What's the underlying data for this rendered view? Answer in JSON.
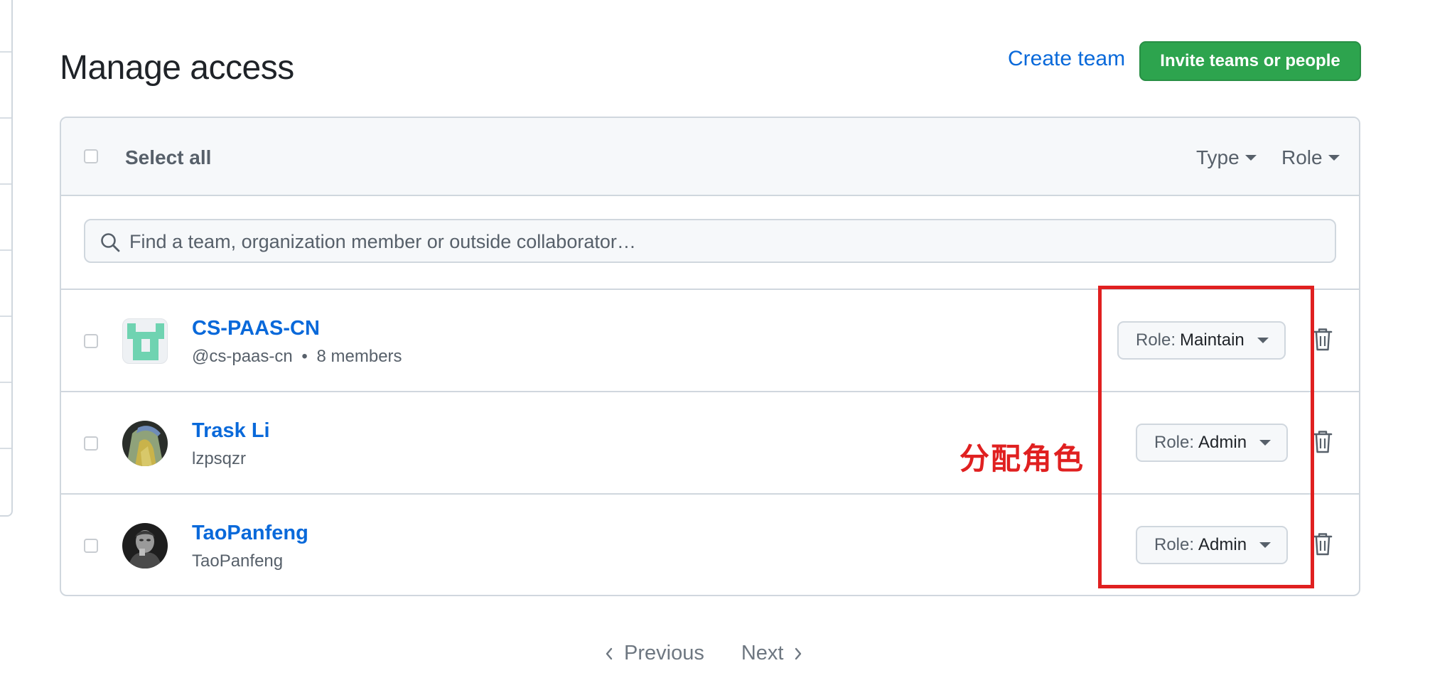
{
  "header": {
    "title": "Manage access",
    "create_team_label": "Create team",
    "invite_label": "Invite teams or people"
  },
  "table": {
    "select_all_label": "Select all",
    "filters": {
      "type_label": "Type",
      "role_label": "Role"
    },
    "search": {
      "placeholder": "Find a team, organization member or outside collaborator…"
    },
    "rows": [
      {
        "name": "CS-PAAS-CN",
        "handle": "@cs-paas-cn",
        "separator": "•",
        "members": "8 members",
        "role_prefix": "Role:",
        "role": "Maintain"
      },
      {
        "name": "Trask Li",
        "handle": "lzpsqzr",
        "role_prefix": "Role:",
        "role": "Admin"
      },
      {
        "name": "TaoPanfeng",
        "handle": "TaoPanfeng",
        "role_prefix": "Role:",
        "role": "Admin"
      }
    ]
  },
  "annotation": {
    "label": "分配角色",
    "color": "#e02020"
  },
  "pagination": {
    "previous_label": "Previous",
    "next_label": "Next"
  },
  "colors": {
    "link": "#0969da",
    "primary_button": "#2da44e",
    "muted_text": "#57606a",
    "border": "#d0d7de"
  }
}
